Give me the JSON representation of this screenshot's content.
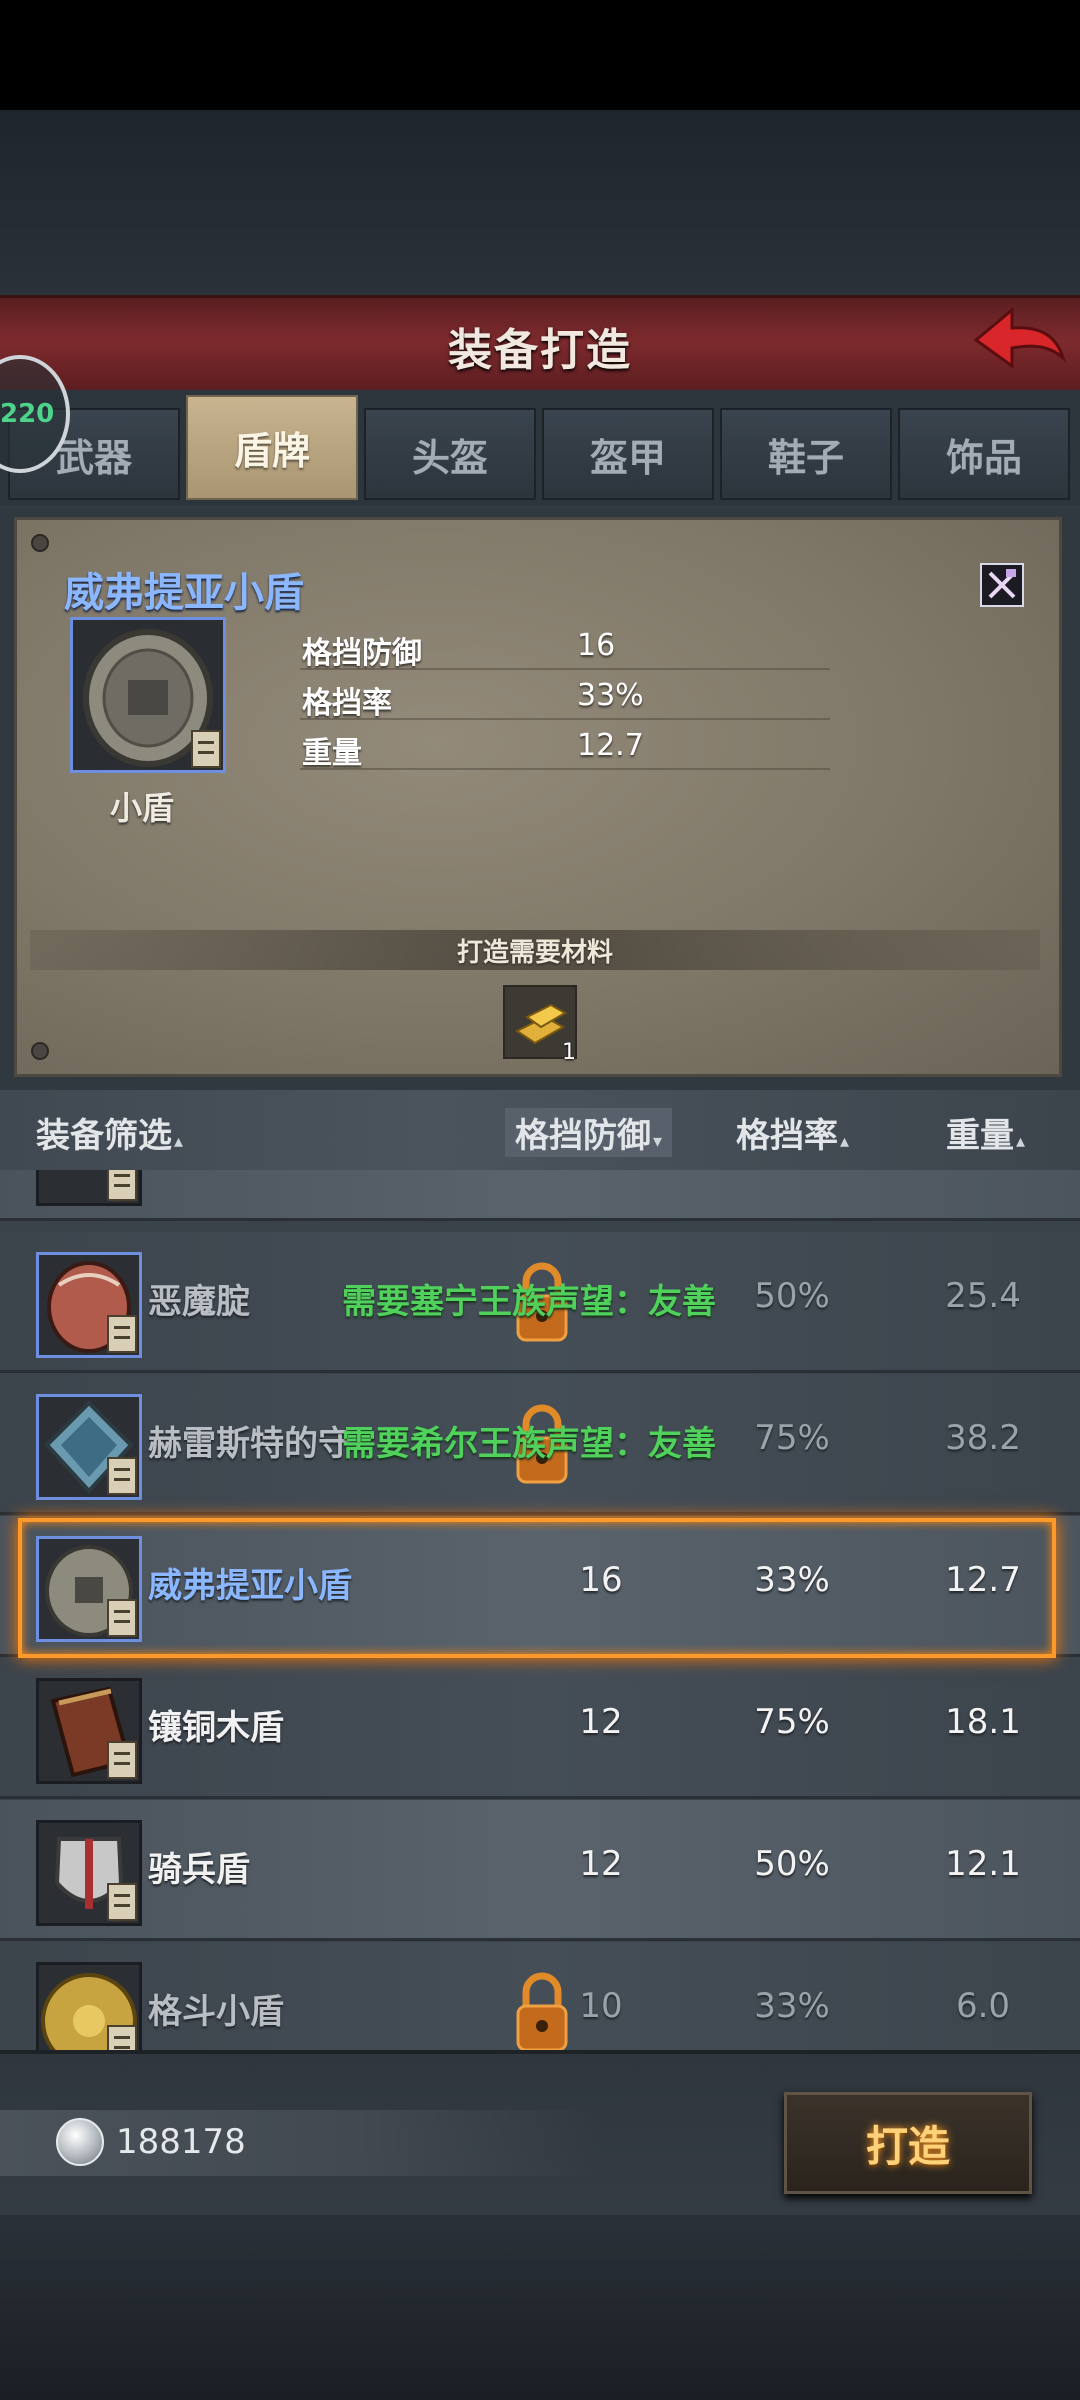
{
  "header": {
    "title": "装备打造"
  },
  "badge": {
    "text": "220"
  },
  "tabs": [
    {
      "label": "武器",
      "active": false
    },
    {
      "label": "盾牌",
      "active": true
    },
    {
      "label": "头盔",
      "active": false
    },
    {
      "label": "盔甲",
      "active": false
    },
    {
      "label": "鞋子",
      "active": false
    },
    {
      "label": "饰品",
      "active": false
    }
  ],
  "detail": {
    "name": "威弗提亚小盾",
    "type": "小盾",
    "stats": [
      {
        "label": "格挡防御",
        "value": "16"
      },
      {
        "label": "格挡率",
        "value": "33%"
      },
      {
        "label": "重量",
        "value": "12.7"
      }
    ],
    "materials_title": "打造需要材料",
    "material": {
      "icon": "gold-bar-icon",
      "count": "1"
    }
  },
  "list_header": {
    "filter": "装备筛选",
    "col_defense": "格挡防御",
    "col_rate": "格挡率",
    "col_weight": "重量",
    "sort_arrow": "▾",
    "inactive_arrow": "▴"
  },
  "items": [
    {
      "name": "恶魔腚",
      "requirement": "需要塞宁王族声望：友善",
      "defense": "",
      "rate": "50%",
      "weight": "25.4",
      "locked": true
    },
    {
      "name": "赫雷斯特的守",
      "requirement": "需要希尔王族声望：友善",
      "defense": "",
      "rate": "75%",
      "weight": "38.2",
      "locked": true
    },
    {
      "name": "威弗提亚小盾",
      "requirement": "",
      "defense": "16",
      "rate": "33%",
      "weight": "12.7",
      "locked": false,
      "selected": true
    },
    {
      "name": "镶铜木盾",
      "requirement": "",
      "defense": "12",
      "rate": "75%",
      "weight": "18.1",
      "locked": false
    },
    {
      "name": "骑兵盾",
      "requirement": "",
      "defense": "12",
      "rate": "50%",
      "weight": "12.1",
      "locked": false
    },
    {
      "name": "格斗小盾",
      "requirement": "",
      "defense": "10",
      "rate": "33%",
      "weight": "6.0",
      "locked": true
    }
  ],
  "footer": {
    "currency": "188178",
    "forge_label": "打造"
  },
  "colors": {
    "accent_blue": "#8ab7ff",
    "requirement_green": "#4fd15b",
    "selection_orange": "#ff9a2a",
    "banner_red": "#7d2a2d"
  }
}
